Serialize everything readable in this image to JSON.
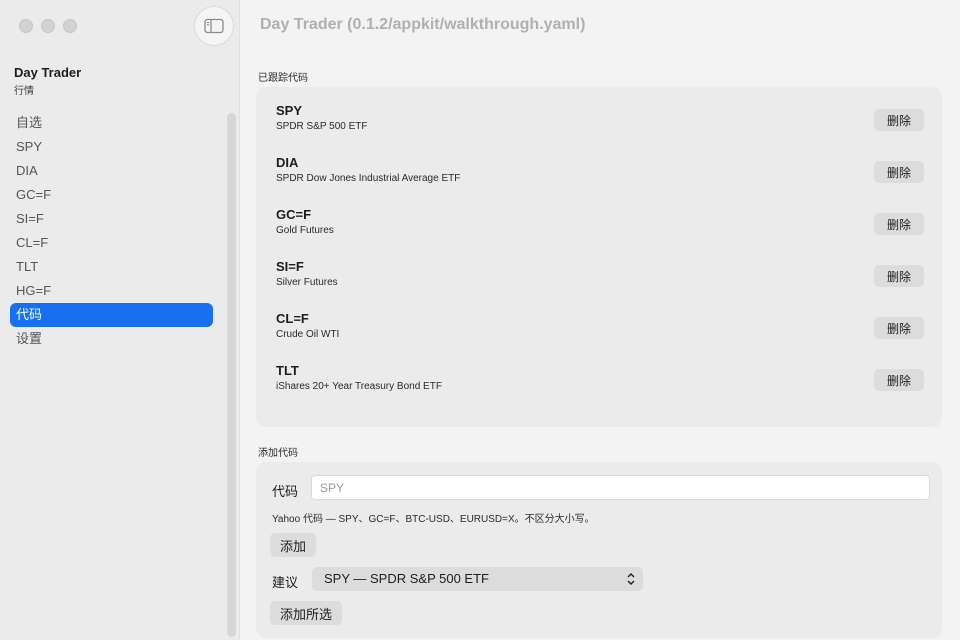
{
  "window": {
    "title": "Day Trader (0.1.2/appkit/walkthrough.yaml)"
  },
  "sidebar": {
    "app_name": "Day Trader",
    "app_subtitle": "行情",
    "items": [
      {
        "label": "自选",
        "active": false
      },
      {
        "label": "SPY",
        "active": false
      },
      {
        "label": "DIA",
        "active": false
      },
      {
        "label": "GC=F",
        "active": false
      },
      {
        "label": "SI=F",
        "active": false
      },
      {
        "label": "CL=F",
        "active": false
      },
      {
        "label": "TLT",
        "active": false
      },
      {
        "label": "HG=F",
        "active": false
      },
      {
        "label": "代码",
        "active": true
      },
      {
        "label": "设置",
        "active": false
      }
    ]
  },
  "tracked": {
    "section_title": "已跟踪代码",
    "delete_label": "删除",
    "tickers": [
      {
        "symbol": "SPY",
        "name": "SPDR S&P 500 ETF"
      },
      {
        "symbol": "DIA",
        "name": "SPDR Dow Jones Industrial Average ETF"
      },
      {
        "symbol": "GC=F",
        "name": "Gold Futures"
      },
      {
        "symbol": "SI=F",
        "name": "Silver Futures"
      },
      {
        "symbol": "CL=F",
        "name": "Crude Oil WTI"
      },
      {
        "symbol": "TLT",
        "name": "iShares 20+ Year Treasury Bond ETF"
      }
    ]
  },
  "add": {
    "section_title": "添加代码",
    "code_label": "代码",
    "code_placeholder": "SPY",
    "code_value": "",
    "hint": "Yahoo 代码 — SPY、GC=F、BTC-USD、EURUSD=X。不区分大小写。",
    "add_button": "添加",
    "suggest_label": "建议",
    "suggest_value": "SPY — SPDR S&P 500 ETF",
    "add_selected_button": "添加所选"
  },
  "colors": {
    "accent": "#1670f0",
    "sidebar_bg": "#ebebeb",
    "panel_bg": "#ebebeb"
  },
  "icons": {
    "sidebar_toggle": "sidebar-toggle-icon",
    "select_arrows": "chevron-up-down-icon"
  }
}
